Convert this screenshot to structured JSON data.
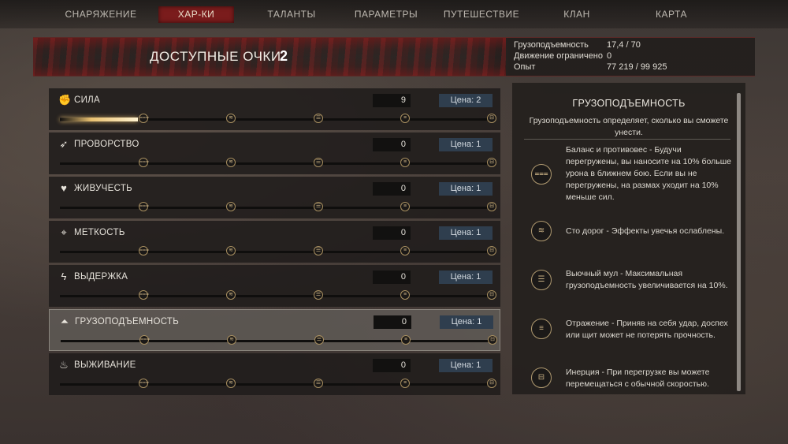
{
  "nav": {
    "tabs": [
      "СНАРЯЖЕНИЕ",
      "ХАР-КИ",
      "ТАЛАНТЫ",
      "ПАРАМЕТРЫ",
      "ПУТЕШЕСТВИЕ",
      "КЛАН",
      "КАРТА"
    ],
    "active_tab": "ХАР-КИ"
  },
  "header": {
    "points_label": "ДОСТУПНЫЕ ОЧКИ",
    "points_value": "2",
    "stats": [
      {
        "label": "Грузоподъемность",
        "value": "17,4 / 70"
      },
      {
        "label": "Движение ограничено",
        "value": "0"
      },
      {
        "label": "Опыт",
        "value": "77 219 / 99 925"
      }
    ]
  },
  "attributes": [
    {
      "name": "СИЛА",
      "icon": "fist-icon",
      "value": "9",
      "cost": "Цена: 2",
      "progress_fraction": 0.18
    },
    {
      "name": "ПРОВОРСТВО",
      "icon": "runner-icon",
      "value": "0",
      "cost": "Цена: 1",
      "progress_fraction": 0
    },
    {
      "name": "ЖИВУЧЕСТЬ",
      "icon": "heart-icon",
      "value": "0",
      "cost": "Цена: 1",
      "progress_fraction": 0
    },
    {
      "name": "МЕТКОСТЬ",
      "icon": "crosshair-icon",
      "value": "0",
      "cost": "Цена: 1",
      "progress_fraction": 0
    },
    {
      "name": "ВЫДЕРЖКА",
      "icon": "lightning-icon",
      "value": "0",
      "cost": "Цена: 1",
      "progress_fraction": 0
    },
    {
      "name": "ГРУЗОПОДЪЕМНОСТЬ",
      "icon": "weight-icon",
      "value": "0",
      "cost": "Цена: 1",
      "progress_fraction": 0
    },
    {
      "name": "ВЫЖИВАНИЕ",
      "icon": "campfire-icon",
      "value": "0",
      "cost": "Цена: 1",
      "progress_fraction": 0
    }
  ],
  "selected_attribute": "ГРУЗОПОДЪЕМНОСТЬ",
  "details": {
    "title": "ГРУЗОПОДЪЕМНОСТЬ",
    "description": "Грузоподъемность определяет, сколько вы сможете унести.",
    "perks": [
      {
        "icon": "balance-perk-icon",
        "text": "Баланс и противовес - Будучи перегружены, вы наносите на 10% больше урона в ближнем бою. Если вы не перегружены, на размах уходит на 10% меньше сил."
      },
      {
        "icon": "road-perk-icon",
        "text": "Сто дорог - Эффекты увечья ослаблены."
      },
      {
        "icon": "mule-perk-icon",
        "text": "Вьючный мул - Максимальная грузоподъемность увеличивается на 10%."
      },
      {
        "icon": "deflect-perk-icon",
        "text": "Отражение - Приняв на себя удар, доспех или щит может не потерять прочность."
      },
      {
        "icon": "inertia-perk-icon",
        "text": "Инерция - При перегрузке вы можете перемещаться с обычной скоростью."
      }
    ]
  }
}
